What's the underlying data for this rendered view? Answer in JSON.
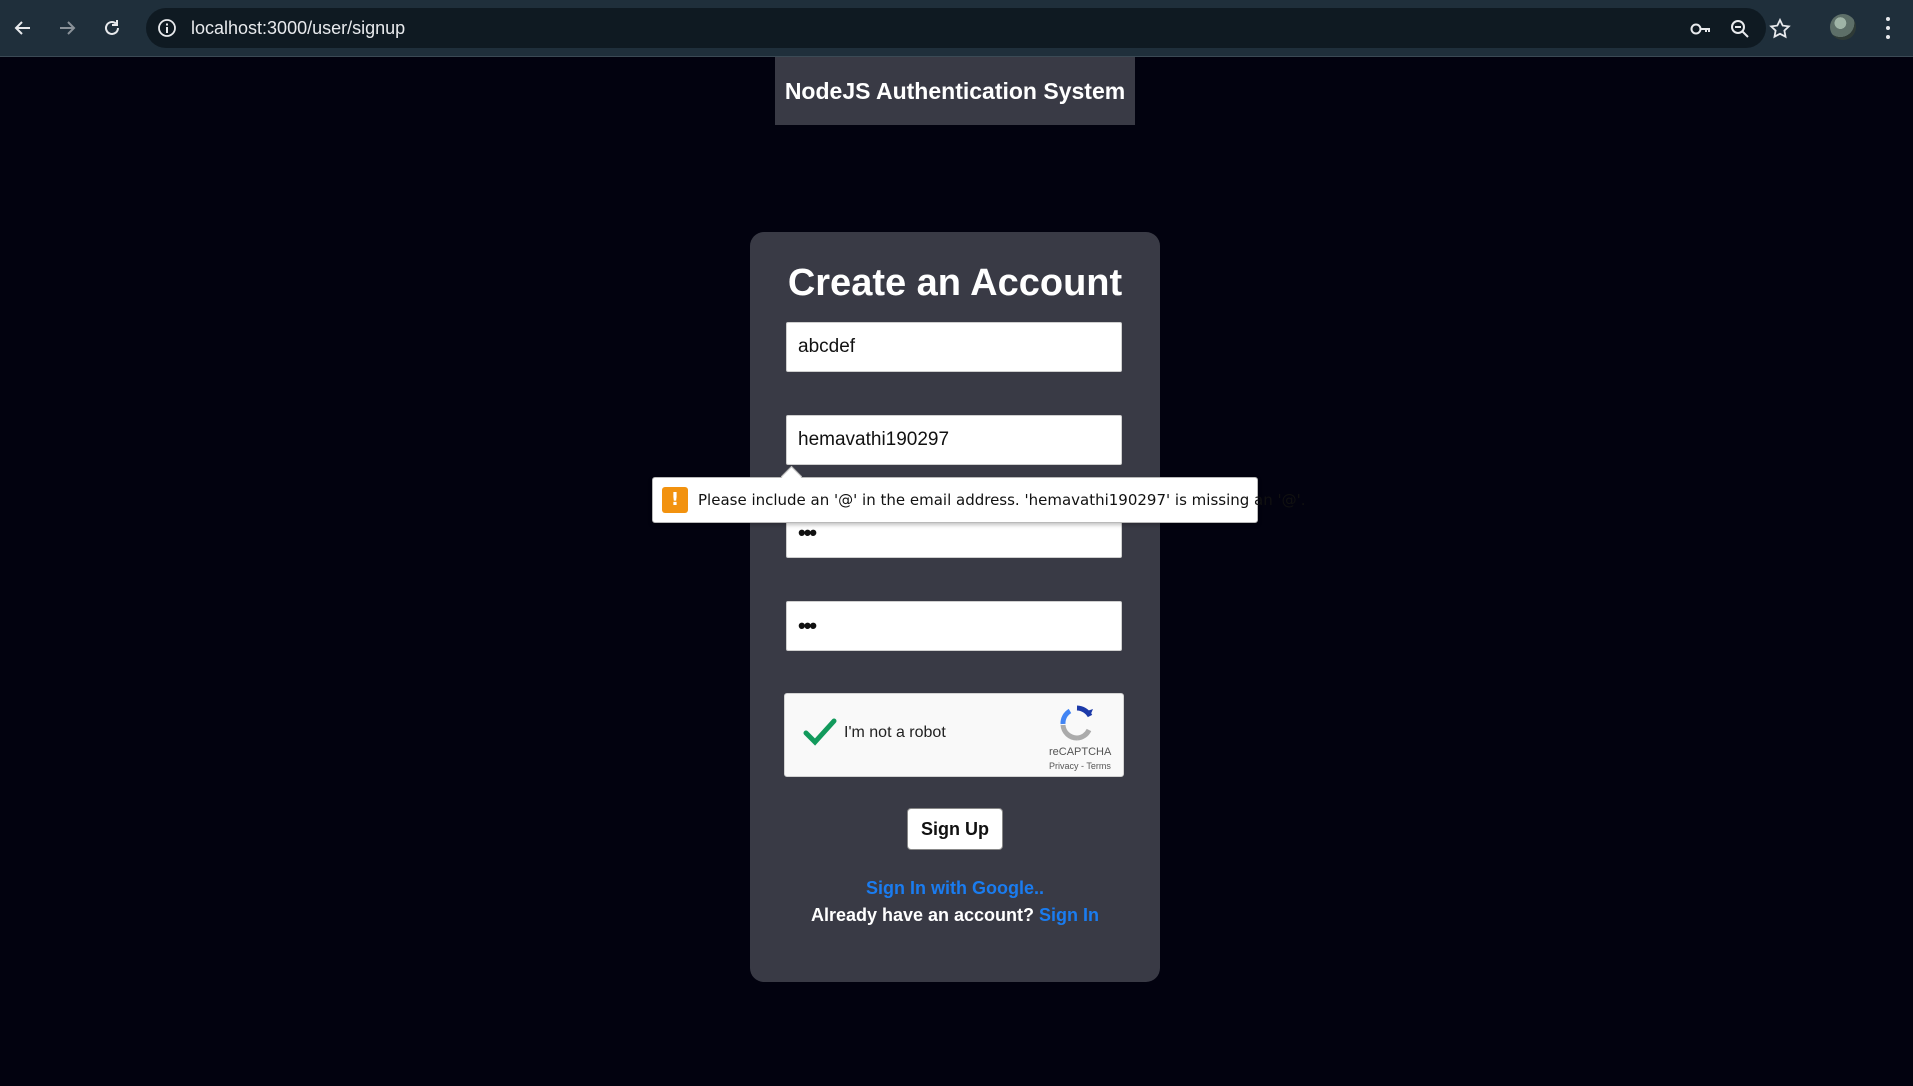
{
  "browser": {
    "url": "localhost:3000/user/signup"
  },
  "header": {
    "brand": "NodeJS Authentication System"
  },
  "form": {
    "title": "Create an Account",
    "name_value": "abcdef",
    "email_value": "hemavathi190297",
    "password_value": "•••",
    "confirm_value": "•••",
    "captcha_label": "I'm not a robot",
    "captcha_brand": "reCAPTCHA",
    "captcha_links": "Privacy - Terms",
    "captcha_checked": true,
    "submit_label": "Sign Up",
    "google_link": "Sign In with Google..",
    "already_text": "Already have an account?",
    "signin_link": "Sign In"
  },
  "validation": {
    "message": "Please include an '@' in the email address. 'hemavathi190297' is missing an '@'."
  },
  "colors": {
    "page_bg": "#02020f",
    "card_bg": "#393a45",
    "link": "#1a7cf0",
    "warning": "#f2920f"
  }
}
